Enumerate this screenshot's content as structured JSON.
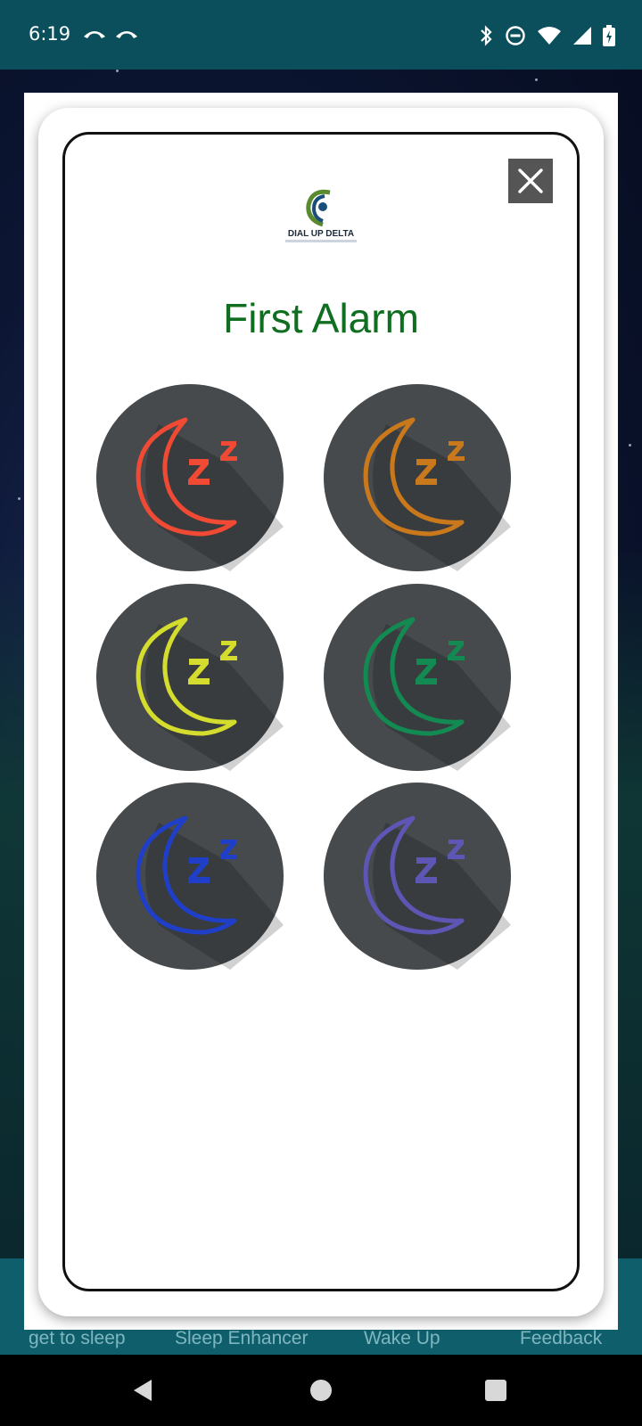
{
  "status_bar": {
    "time": "6:19"
  },
  "dialog": {
    "logo_text": "DIAL UP DELTA",
    "title": "First Alarm",
    "close_icon": "close-icon"
  },
  "alarm_options": [
    {
      "color_name": "red",
      "color": "#f04a34",
      "icon": "sleep-moon-icon"
    },
    {
      "color_name": "orange",
      "color": "#c9791c",
      "icon": "sleep-moon-icon"
    },
    {
      "color_name": "yellow",
      "color": "#d4dd2e",
      "icon": "sleep-moon-icon"
    },
    {
      "color_name": "green",
      "color": "#128a52",
      "icon": "sleep-moon-icon"
    },
    {
      "color_name": "blue",
      "color": "#1f3fc8",
      "icon": "sleep-moon-icon"
    },
    {
      "color_name": "purple",
      "color": "#5e56b4",
      "icon": "sleep-moon-icon"
    }
  ],
  "background_nav": {
    "items": [
      "get to sleep",
      "Sleep Enhancer",
      "Wake Up",
      "Feedback"
    ]
  },
  "colors": {
    "status_bar": "#0b4f5c",
    "title": "#0f6e1f",
    "alarm_circle": "#464a4c"
  }
}
